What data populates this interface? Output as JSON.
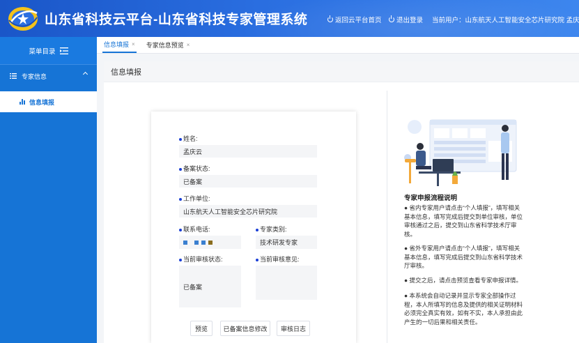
{
  "header": {
    "title": "山东省科技云平台-山东省科技专家管理系统",
    "back_link": "返回云平台首页",
    "logout_link": "退出登录",
    "current_user": "当前用户：山东航天人工智能安全芯片研究院 孟庆云"
  },
  "sidebar": {
    "menu_label": "菜单目录",
    "group_label": "专家信息",
    "items": [
      {
        "label": "信息填报"
      }
    ]
  },
  "tabs": [
    {
      "label": "信息填报",
      "close": "×"
    },
    {
      "label": "专家信息预览",
      "close": "×"
    }
  ],
  "main": {
    "page_title": "信息填报"
  },
  "form": {
    "name_label": "姓名:",
    "name_value": "孟庆云",
    "status_label": "备案状态:",
    "status_value": "已备案",
    "org_label": "工作单位:",
    "org_value": "山东航天人工智能安全芯片研究院",
    "phone_label": "联系电话:",
    "phone_block_colors": [
      "#3a7fd0",
      "#3a7fd0",
      "#3a7fd0",
      "#8a6d1f"
    ],
    "category_label": "专家类别:",
    "category_value": "技术研发专家",
    "audit_status_label": "当前审核状态:",
    "audit_status_value": "已备案",
    "audit_opinion_label": "当前审核意见:",
    "audit_opinion_value": "",
    "buttons": {
      "preview": "预览",
      "modify": "已备案信息修改",
      "log": "审核日志"
    }
  },
  "flow": {
    "title": "专家申报流程说明",
    "p1": "● 省内专家用户请点击“个人填报”，填写相关基本信息，填写完成后提交到单位审核，单位审核通过之后，提交到山东省科学技术厅审核。",
    "p2": "● 省外专家用户请点击“个人填报”，填写相关基本信息，填写完成后提交到山东省科学技术厅审核。",
    "p3": "● 提交之后，请点击预览查看专家申报详情。",
    "p4": "● 本系统会自动记录并显示专家全部操作过程，本人所填写的信息及提供的相关证明材料必须完全真实有效，如有不实，本人承担由此产生的一切后果和相关责任。"
  },
  "colors": {
    "header": "#1a56c8",
    "sidebar": "#1674d6",
    "accent": "#1674d6",
    "dot": "#1a3fd6"
  }
}
